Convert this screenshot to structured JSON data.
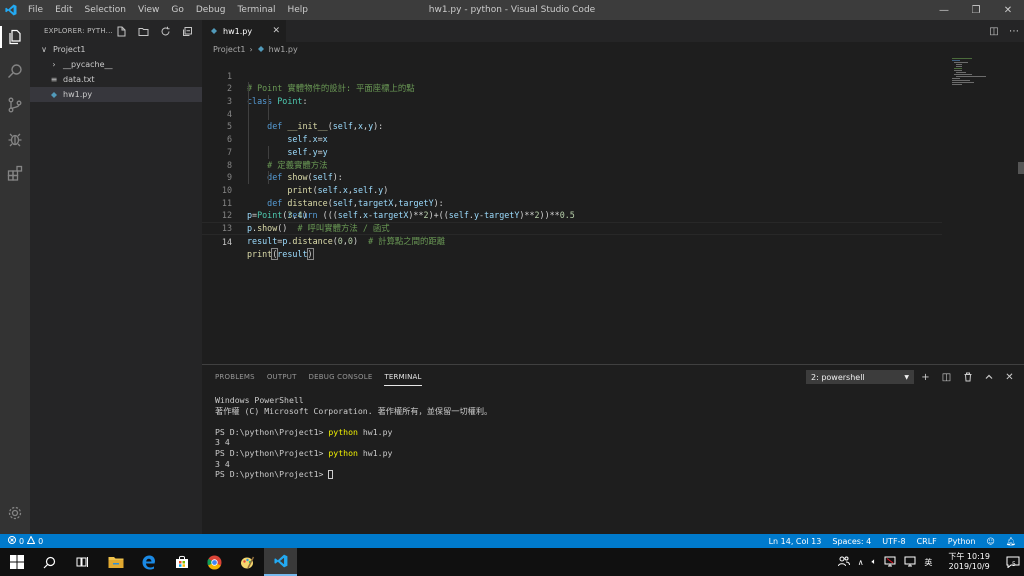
{
  "window": {
    "title": "hw1.py - python - Visual Studio Code",
    "menu": [
      "File",
      "Edit",
      "Selection",
      "View",
      "Go",
      "Debug",
      "Terminal",
      "Help"
    ]
  },
  "sidebar": {
    "header": "EXPLORER: PYTH...",
    "project": "Project1",
    "items": [
      {
        "label": "__pycache__"
      },
      {
        "label": "data.txt"
      },
      {
        "label": "hw1.py"
      }
    ]
  },
  "editor": {
    "tab_label": "hw1.py",
    "breadcrumb": {
      "folder": "Project1",
      "file": "hw1.py"
    },
    "line_numbers": [
      "1",
      "2",
      "3",
      "4",
      "5",
      "6",
      "7",
      "8",
      "9",
      "10",
      "11",
      "12",
      "13",
      "14"
    ],
    "current_line": 14
  },
  "panel": {
    "tabs": [
      "PROBLEMS",
      "OUTPUT",
      "DEBUG CONSOLE",
      "TERMINAL"
    ],
    "active_tab": "TERMINAL",
    "terminal_select": "2: powershell",
    "terminal": {
      "banner1": "Windows PowerShell",
      "banner2": "著作權 (C) Microsoft Corporation. 著作權所有，並保留一切權利。",
      "prompt": "PS D:\\python\\Project1> ",
      "cmd": "python",
      "arg": " hw1.py",
      "out": "3 4"
    }
  },
  "statusbar": {
    "errors": "0",
    "warnings": "0",
    "position": "Ln 14, Col 13",
    "spaces": "Spaces: 4",
    "encoding": "UTF-8",
    "eol": "CRLF",
    "language": "Python"
  },
  "taskbar": {
    "ime": "英",
    "time": "下午 10:19",
    "date": "2019/10/9",
    "notifications": "5"
  },
  "colors": {
    "accent": "#007acc",
    "keyword": "#569cd6",
    "comment": "#6a9955",
    "function": "#dcdcaa",
    "class": "#4ec9b0",
    "number": "#b5cea8",
    "terminal_command": "#f2f200"
  }
}
